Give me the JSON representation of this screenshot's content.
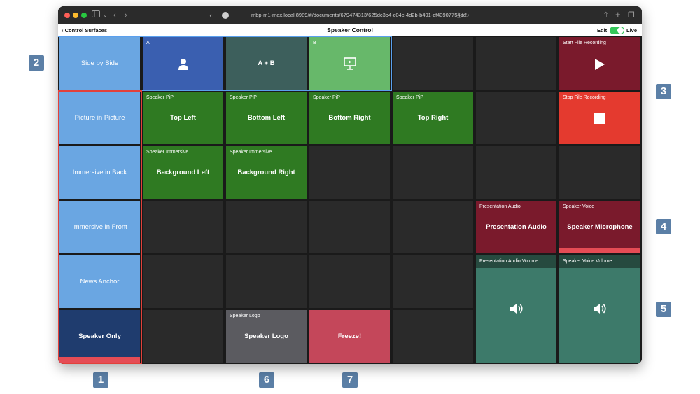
{
  "browser": {
    "url": "mbp-m1-max.local:8989/#/documents/679474313/625dc3b4-c04c-4d2b-b491-cf43907754dd"
  },
  "nav": {
    "back_label": "Control Surfaces",
    "title": "Speaker Control",
    "edit_label": "Edit",
    "live_label": "Live"
  },
  "layouts": {
    "side_by_side": "Side by Side",
    "picture_in_picture": "Picture in Picture",
    "immersive_back": "Immersive in Back",
    "immersive_front": "Immersive in Front",
    "news_anchor": "News Anchor",
    "speaker_only": "Speaker Only"
  },
  "sources": {
    "a_header": "A",
    "ab_label": "A + B",
    "b_header": "B"
  },
  "pip": {
    "header": "Speaker PiP",
    "top_left": "Top Left",
    "bottom_left": "Bottom Left",
    "bottom_right": "Bottom Right",
    "top_right": "Top Right"
  },
  "immersive": {
    "header": "Speaker Immersive",
    "background_left": "Background Left",
    "background_right": "Background Right"
  },
  "recording": {
    "start_label": "Start File Recording",
    "stop_label": "Stop File Recording"
  },
  "audio": {
    "presentation_header": "Presentation Audio",
    "presentation_label": "Presentation Audio",
    "voice_header": "Speaker Voice",
    "voice_label": "Speaker Microphone",
    "presentation_volume_header": "Presentation Audio Volume",
    "voice_volume_header": "Speaker Voice Volume"
  },
  "logo": {
    "header": "Speaker Logo",
    "label": "Speaker Logo"
  },
  "freeze": {
    "label": "Freeze!"
  },
  "callouts": {
    "c1": "1",
    "c2": "2",
    "c3": "3",
    "c4": "4",
    "c5": "5",
    "c6": "6",
    "c7": "7"
  },
  "colors": {
    "layout_blue": "#6aa6e2",
    "active_navy": "#1f3c6e",
    "pip_green": "#2f7a22",
    "record_maroon": "#7a1a2c",
    "stop_red": "#e43a2f",
    "volume_teal": "#3d7a6a",
    "freeze_rose": "#c4475a",
    "callout": "#5b7fa6"
  },
  "icons": {
    "source_a": "person-icon",
    "source_b": "presentation-icon",
    "start": "play-icon",
    "stop": "stop-icon",
    "volume": "speaker-volume-icon"
  }
}
